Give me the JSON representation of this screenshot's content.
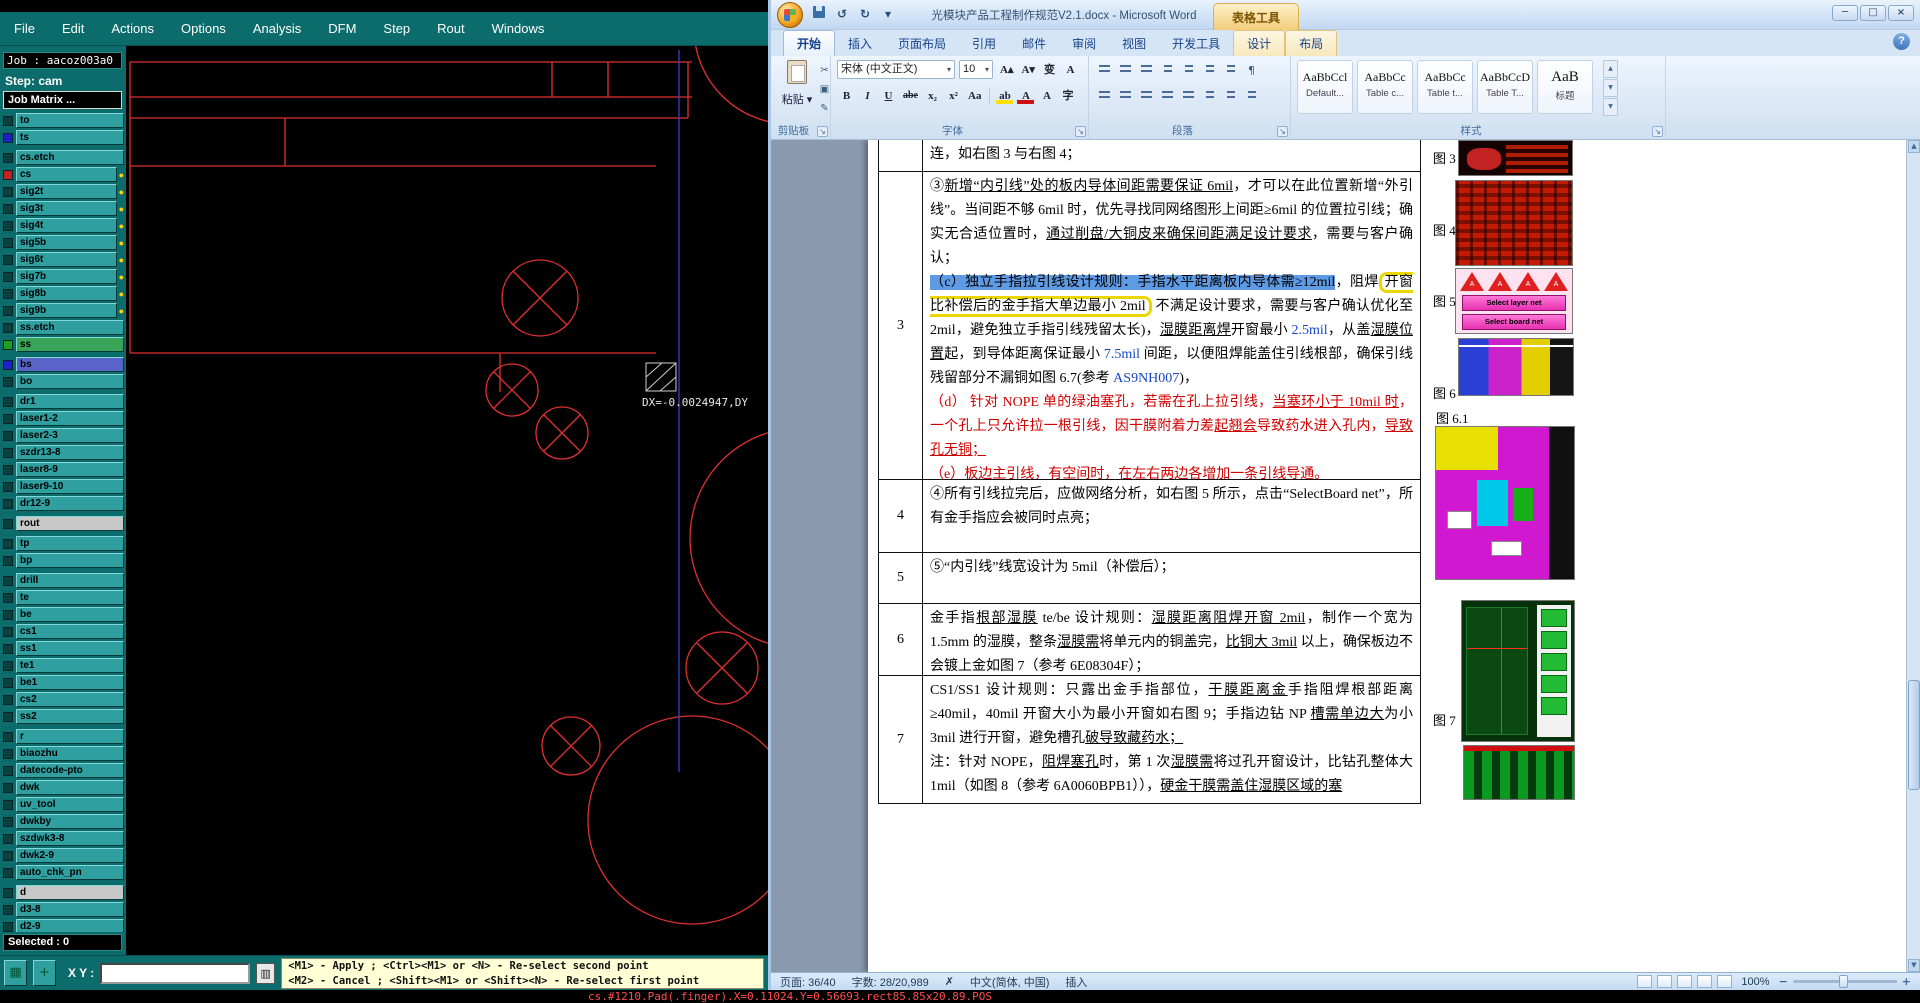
{
  "icons": {
    "dropdown": "▾",
    "launcher": "↘",
    "undo": "↺",
    "redo": "↻",
    "cut": "✂",
    "copy": "▣",
    "painter": "✎",
    "pilcrow": "¶",
    "help": "?",
    "min": "─",
    "max": "□",
    "close": "×",
    "grid": "▦",
    "cross": "+",
    "opt": "▥",
    "spell": "✗",
    "zoom_out": "−",
    "zoom_in": "+",
    "gal_up": "▲",
    "gal_down": "▼",
    "gal_more": "▼",
    "dot": "●",
    "grow": "A▴",
    "shrink": "A▾",
    "pinyin": "变",
    "clear": "A",
    "bold": "B",
    "italic": "I",
    "underline": "U",
    "strike": "abe",
    "sub": "x₂",
    "sup": "x²",
    "case": "Aa",
    "highlight": "ab",
    "fontcolor": "A",
    "charborder": "A",
    "enclose": "字",
    "scroll_up": "▲",
    "scroll_down": "▼",
    "tri_a": "A"
  },
  "cam": {
    "menus": [
      "File",
      "Edit",
      "Actions",
      "Options",
      "Analysis",
      "DFM",
      "Step",
      "Rout",
      "Windows"
    ],
    "job_label": "Job : aacoz003a0",
    "step_label": "Step: cam",
    "job_matrix_label": "Job Matrix ...",
    "selected_label": "Selected : 0",
    "xy_label": "X Y :",
    "xy_value": "",
    "hints": [
      "<M1> - Apply ; <Ctrl><M1> or <N> - Re-select second point",
      "<M2> - Cancel ; <Shift><M1> or <Shift><N> - Re-select first point"
    ],
    "canvas_readout": "DX=-0.0024947,DY",
    "status_text": "cs.#1210.Pad(.finger).X=0.11024.Y=0.56693.rect85.85x20.89.POS",
    "colors": {
      "menubar": "#0c6b6b",
      "button": "#2f9f9f",
      "trace": "#e03030",
      "guide": "#3d3dd6"
    },
    "layers": [
      {
        "n": "to",
        "sw": "#0a4040"
      },
      {
        "n": "ts",
        "sw": "#2020c8"
      },
      {
        "n": "cs.etch",
        "sw": "#0a4040",
        "gap": true
      },
      {
        "n": "cs",
        "sw": "#c82020",
        "dot": true
      },
      {
        "n": "sig2t",
        "sw": "#0a4040",
        "dot": true
      },
      {
        "n": "sig3t",
        "sw": "#0a4040",
        "dot": true
      },
      {
        "n": "sig4t",
        "sw": "#0a4040",
        "dot": true
      },
      {
        "n": "sig5b",
        "sw": "#0a4040",
        "dot": true
      },
      {
        "n": "sig6t",
        "sw": "#0a4040",
        "dot": true
      },
      {
        "n": "sig7b",
        "sw": "#0a4040",
        "dot": true
      },
      {
        "n": "sig8b",
        "sw": "#0a4040",
        "dot": true
      },
      {
        "n": "sig9b",
        "sw": "#0a4040",
        "dot": true
      },
      {
        "n": "ss.etch",
        "sw": "#0a4040"
      },
      {
        "n": "ss",
        "sw": "#20a020",
        "bg": "#3aa55a"
      },
      {
        "n": "bs",
        "sw": "#2020c8",
        "bg": "#5864c8",
        "gap": true
      },
      {
        "n": "bo",
        "sw": "#0a4040"
      },
      {
        "n": "dr1",
        "sw": "#0a4040",
        "gap": true
      },
      {
        "n": "laser1-2",
        "sw": "#0a4040"
      },
      {
        "n": "laser2-3",
        "sw": "#0a4040"
      },
      {
        "n": "szdr13-8",
        "sw": "#0a4040"
      },
      {
        "n": "laser8-9",
        "sw": "#0a4040"
      },
      {
        "n": "laser9-10",
        "sw": "#0a4040"
      },
      {
        "n": "dr12-9",
        "sw": "#0a4040"
      },
      {
        "n": "rout",
        "sw": "#0a4040",
        "bg": "#c8c8c8",
        "gap": true
      },
      {
        "n": "tp",
        "sw": "#0a4040",
        "gap": true
      },
      {
        "n": "bp",
        "sw": "#0a4040"
      },
      {
        "n": "drill",
        "sw": "#0a4040",
        "gap": true
      },
      {
        "n": "te",
        "sw": "#0a4040"
      },
      {
        "n": "be",
        "sw": "#0a4040"
      },
      {
        "n": "cs1",
        "sw": "#0a4040"
      },
      {
        "n": "ss1",
        "sw": "#0a4040"
      },
      {
        "n": "te1",
        "sw": "#0a4040"
      },
      {
        "n": "be1",
        "sw": "#0a4040"
      },
      {
        "n": "cs2",
        "sw": "#0a4040"
      },
      {
        "n": "ss2",
        "sw": "#0a4040"
      },
      {
        "n": "r",
        "sw": "#0a4040",
        "gap": true
      },
      {
        "n": "biaozhu",
        "sw": "#0a4040"
      },
      {
        "n": "datecode-pto",
        "sw": "#0a4040"
      },
      {
        "n": "dwk",
        "sw": "#0a4040"
      },
      {
        "n": "uv_tool",
        "sw": "#0a4040"
      },
      {
        "n": "dwkby",
        "sw": "#0a4040"
      },
      {
        "n": "szdwk3-8",
        "sw": "#0a4040"
      },
      {
        "n": "dwk2-9",
        "sw": "#0a4040"
      },
      {
        "n": "auto_chk_pn",
        "sw": "#0a4040"
      },
      {
        "n": "d",
        "sw": "#0a4040",
        "bg": "#c8c8c8",
        "gap": true
      },
      {
        "n": "d3-8",
        "sw": "#0a4040"
      },
      {
        "n": "d2-9",
        "sw": "#0a4040"
      }
    ]
  },
  "word": {
    "title": "光模块产品工程制作规范V2.1.docx - Microsoft Word",
    "context_group": "表格工具",
    "tabs": [
      "开始",
      "插入",
      "页面布局",
      "引用",
      "邮件",
      "审阅",
      "视图",
      "开发工具"
    ],
    "context_tabs": [
      "设计",
      "布局"
    ],
    "active_tab": "开始",
    "ribbon": {
      "clipboard": {
        "label": "剪贴板",
        "paste_label": "粘贴"
      },
      "font": {
        "label": "字体",
        "font_name": "宋体 (中文正文)",
        "font_size": "10"
      },
      "paragraph": {
        "label": "段落"
      },
      "styles": {
        "label": "样式",
        "items": [
          {
            "preview": "AaBbCcl",
            "name": "Default..."
          },
          {
            "preview": "AaBbCc",
            "name": "Table c..."
          },
          {
            "preview": "AaBbCc",
            "name": "Table t..."
          },
          {
            "preview": "AaBbCcD",
            "name": "Table T..."
          },
          {
            "preview": "AaB",
            "name": "标题"
          }
        ]
      }
    },
    "document": {
      "figures": [
        "图 3",
        "图 4",
        "图 5",
        "图 6",
        "图 6.1",
        "图 7"
      ],
      "fig5_buttons": [
        "Select layer net",
        "Select board net"
      ],
      "rows": [
        {
          "num": "",
          "paras": [
            [
              {
                "t": "连，如右图 3 与右图 4；",
                "s": "n"
              }
            ]
          ]
        },
        {
          "num": "3",
          "paras": [
            [
              {
                "t": "③",
                "s": "n"
              },
              {
                "t": "新增“内引线”处的板内导体间距需要保证 6mil",
                "s": "u"
              },
              {
                "t": "，才可以在此位置新增“外引线”。当间距不够 6mil 时，优先寻找同网络图形上间距≥6mil 的位置拉引线；确实无合适位置时，",
                "s": "n"
              },
              {
                "t": "通过削盘/大铜皮来确保间距满足设计要求",
                "s": "u"
              },
              {
                "t": "，需要与客户确认；",
                "s": "n"
              }
            ],
            [
              {
                "t": "（c）独立手指拉引线设计规则：手指水平距离板内导体需≥12mil",
                "s": "sel"
              },
              {
                "t": "，阻焊",
                "s": "n"
              },
              {
                "t": "开窗比补偿后的金手指大单边最小 2mil",
                "s": "box"
              },
              {
                "t": " 不满足设计要求，需要与客户确认优化至 2mil，避免独立手指引线残留太长)，",
                "s": "n"
              },
              {
                "t": "湿膜距离焊",
                "s": "u"
              },
              {
                "t": "开窗最小 ",
                "s": "n"
              },
              {
                "t": "2.5mil",
                "s": "b"
              },
              {
                "t": "，从盖",
                "s": "n"
              },
              {
                "t": "湿膜位置",
                "s": "u"
              },
              {
                "t": "起，到导体距离保证最小 ",
                "s": "n"
              },
              {
                "t": "7.5mil",
                "s": "b"
              },
              {
                "t": " 间距，以便阻焊能盖住引线根部，确保引线残留部分不漏铜如图 6.7(参考 ",
                "s": "n"
              },
              {
                "t": "AS9NH007",
                "s": "b"
              },
              {
                "t": ")，",
                "s": "n"
              }
            ],
            [
              {
                "t": "（d） 针对 NOPE 单的绿油塞孔，若需在孔上拉引线，",
                "s": "r"
              },
              {
                "t": "当塞环小于 10mil 时",
                "s": "ru"
              },
              {
                "t": "，一个孔上只允许拉一根引线，因干膜附着力差",
                "s": "r"
              },
              {
                "t": "起翘会",
                "s": "ru"
              },
              {
                "t": "导致药水进入孔内，",
                "s": "r"
              },
              {
                "t": "导致孔无铜；",
                "s": "ru"
              }
            ],
            [
              {
                "t": "（e）板边主引线，",
                "s": "r"
              },
              {
                "t": "有空间时，在左右两边各增加一条引线导通。",
                "s": "ru"
              }
            ]
          ]
        },
        {
          "num": "4",
          "paras": [
            [
              {
                "t": "④所有引线拉完后，应做网络分析，如右图 5 所示，点击“SelectBoard net”，所有金手指应会被同时点亮；",
                "s": "n"
              }
            ]
          ]
        },
        {
          "num": "5",
          "paras": [
            [
              {
                "t": "⑤“内引线”线宽设计为 5mil（补偿后）；",
                "s": "n"
              }
            ]
          ]
        },
        {
          "num": "6",
          "paras": [
            [
              {
                "t": "金手指",
                "s": "n"
              },
              {
                "t": "根部湿膜",
                "s": "u"
              },
              {
                "t": " te/be 设计规则：",
                "s": "n"
              },
              {
                "t": "湿膜距离阻焊开窗 2mil",
                "s": "u"
              },
              {
                "t": "，制作一个宽为 1.5mm 的湿膜，整条",
                "s": "n"
              },
              {
                "t": "湿膜需",
                "s": "u"
              },
              {
                "t": "将单元内的铜盖完，",
                "s": "n"
              },
              {
                "t": "比铜大 3mil",
                "s": "u"
              },
              {
                "t": " 以上，确保板边不会镀上金如图 7（参考 6E08304F）；",
                "s": "n"
              }
            ]
          ]
        },
        {
          "num": "7",
          "paras": [
            [
              {
                "t": "CS1/SS1 设计规则：只露出金手指部位，",
                "s": "n"
              },
              {
                "t": "干膜距离金",
                "s": "u"
              },
              {
                "t": "手指阻焊根部距离≥40mil，40mil 开窗大小为最小开窗如右图 9；手指边钻 NP ",
                "s": "n"
              },
              {
                "t": "槽需单边大",
                "s": "u"
              },
              {
                "t": "为小 3mil 进行开窗，避免槽孔",
                "s": "n"
              },
              {
                "t": "破导致藏药水；",
                "s": "u"
              }
            ],
            [
              {
                "t": "注：针对 NOPE，",
                "s": "n"
              },
              {
                "t": "阻焊塞孔",
                "s": "u"
              },
              {
                "t": "时，第 1 次",
                "s": "n"
              },
              {
                "t": "湿膜需",
                "s": "u"
              },
              {
                "t": "将过孔开窗设计，比钻孔整体大 1mil（如图 8（参考 6A0060BPB1）），",
                "s": "n"
              },
              {
                "t": "硬金干膜需盖住湿膜区域的塞",
                "s": "u"
              }
            ]
          ]
        }
      ]
    },
    "status": {
      "page": "页面: 36/40",
      "words": "字数: 28/20,989",
      "lang": "中文(简体, 中国)",
      "mode": "插入",
      "zoom": "100%"
    }
  }
}
